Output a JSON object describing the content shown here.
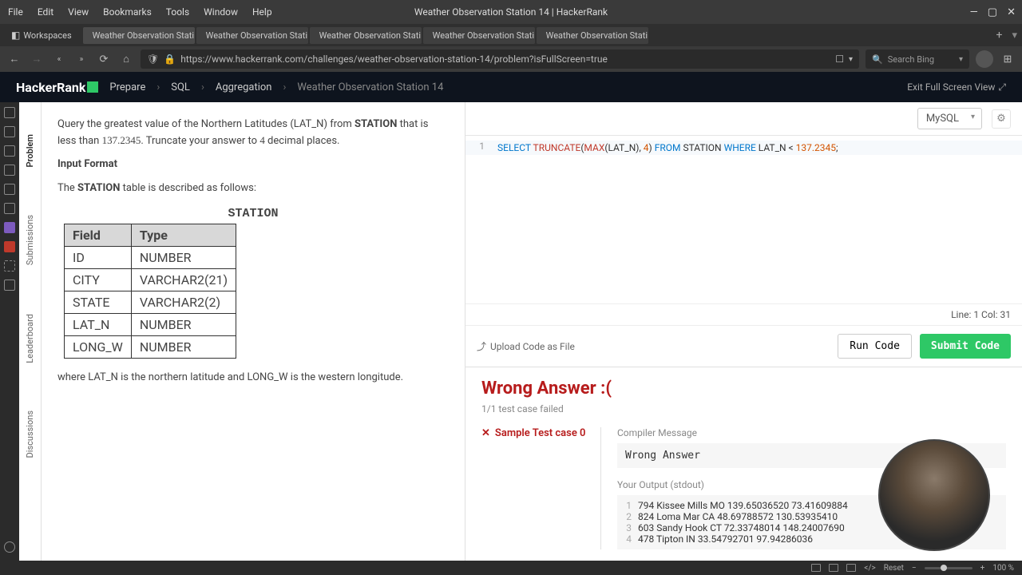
{
  "menubar": {
    "items": [
      "File",
      "Edit",
      "View",
      "Bookmarks",
      "Tools",
      "Window",
      "Help"
    ],
    "title": "Weather Observation Station 14 | HackerRank"
  },
  "tabs": {
    "workspace_label": "Workspaces",
    "items": [
      "Weather Observation Stati",
      "Weather Observation Stati",
      "Weather Observation Stati",
      "Weather Observation Stati",
      "Weather Observation Stati"
    ]
  },
  "navbar": {
    "url": "https://www.hackerrank.com/challenges/weather-observation-station-14/problem?isFullScreen=true",
    "search_placeholder": "Search Bing"
  },
  "header": {
    "logo": "HackerRank",
    "breadcrumbs": [
      "Prepare",
      "SQL",
      "Aggregation",
      "Weather Observation Station 14"
    ],
    "exit_label": "Exit Full Screen View"
  },
  "vtabs": [
    "Problem",
    "Submissions",
    "Leaderboard",
    "Discussions"
  ],
  "problem": {
    "intro_pre": "Query the greatest value of the Northern Latitudes (LAT_N) from ",
    "station": "STATION",
    "intro_mid": " that is less than ",
    "limit": "137.2345",
    "intro_post": ". Truncate your answer to ",
    "dec": "4",
    "intro_end": " decimal places.",
    "input_format": "Input Format",
    "table_intro_pre": "The ",
    "table_intro_post": " table is described as follows:",
    "schema_title": "STATION",
    "schema_headers": [
      "Field",
      "Type"
    ],
    "schema_rows": [
      [
        "ID",
        "NUMBER"
      ],
      [
        "CITY",
        "VARCHAR2(21)"
      ],
      [
        "STATE",
        "VARCHAR2(2)"
      ],
      [
        "LAT_N",
        "NUMBER"
      ],
      [
        "LONG_W",
        "NUMBER"
      ]
    ],
    "footnote": "where LAT_N is the northern latitude and LONG_W is the western longitude."
  },
  "editor": {
    "language": "MySQL",
    "code_tokens": [
      {
        "t": "SELECT ",
        "c": "kw"
      },
      {
        "t": "TRUNCATE",
        "c": "fn"
      },
      {
        "t": "(",
        "c": "paren"
      },
      {
        "t": "MAX",
        "c": "fn"
      },
      {
        "t": "(",
        "c": "paren"
      },
      {
        "t": "LAT_N",
        "c": ""
      },
      {
        "t": ")",
        "c": "paren"
      },
      {
        "t": ", ",
        "c": ""
      },
      {
        "t": "4",
        "c": "num"
      },
      {
        "t": ") ",
        "c": "paren"
      },
      {
        "t": "FROM ",
        "c": "kw"
      },
      {
        "t": "STATION ",
        "c": ""
      },
      {
        "t": "WHERE ",
        "c": "kw"
      },
      {
        "t": "LAT_N ",
        "c": ""
      },
      {
        "t": "< ",
        "c": ""
      },
      {
        "t": "137.2345",
        "c": "num"
      },
      {
        "t": ";",
        "c": ""
      }
    ],
    "cursor": "Line: 1 Col: 31",
    "upload": "Upload Code as File",
    "run": "Run Code",
    "submit": "Submit Code"
  },
  "result": {
    "title": "Wrong Answer :(",
    "sub": "1/1 test case failed",
    "test_case": "Sample Test case 0",
    "compiler_label": "Compiler Message",
    "compiler_msg": "Wrong Answer",
    "stdout_label": "Your Output (stdout)",
    "stdout": [
      "794 Kissee Mills MO 139.65036520 73.41609884",
      "824 Loma Mar CA 48.69788572 130.53935410",
      "603 Sandy Hook CT 72.33748014 148.24007690",
      "478 Tipton IN 33.54792701 97.94286036"
    ]
  },
  "osbar": {
    "reset": "Reset",
    "zoom": "100 %"
  }
}
